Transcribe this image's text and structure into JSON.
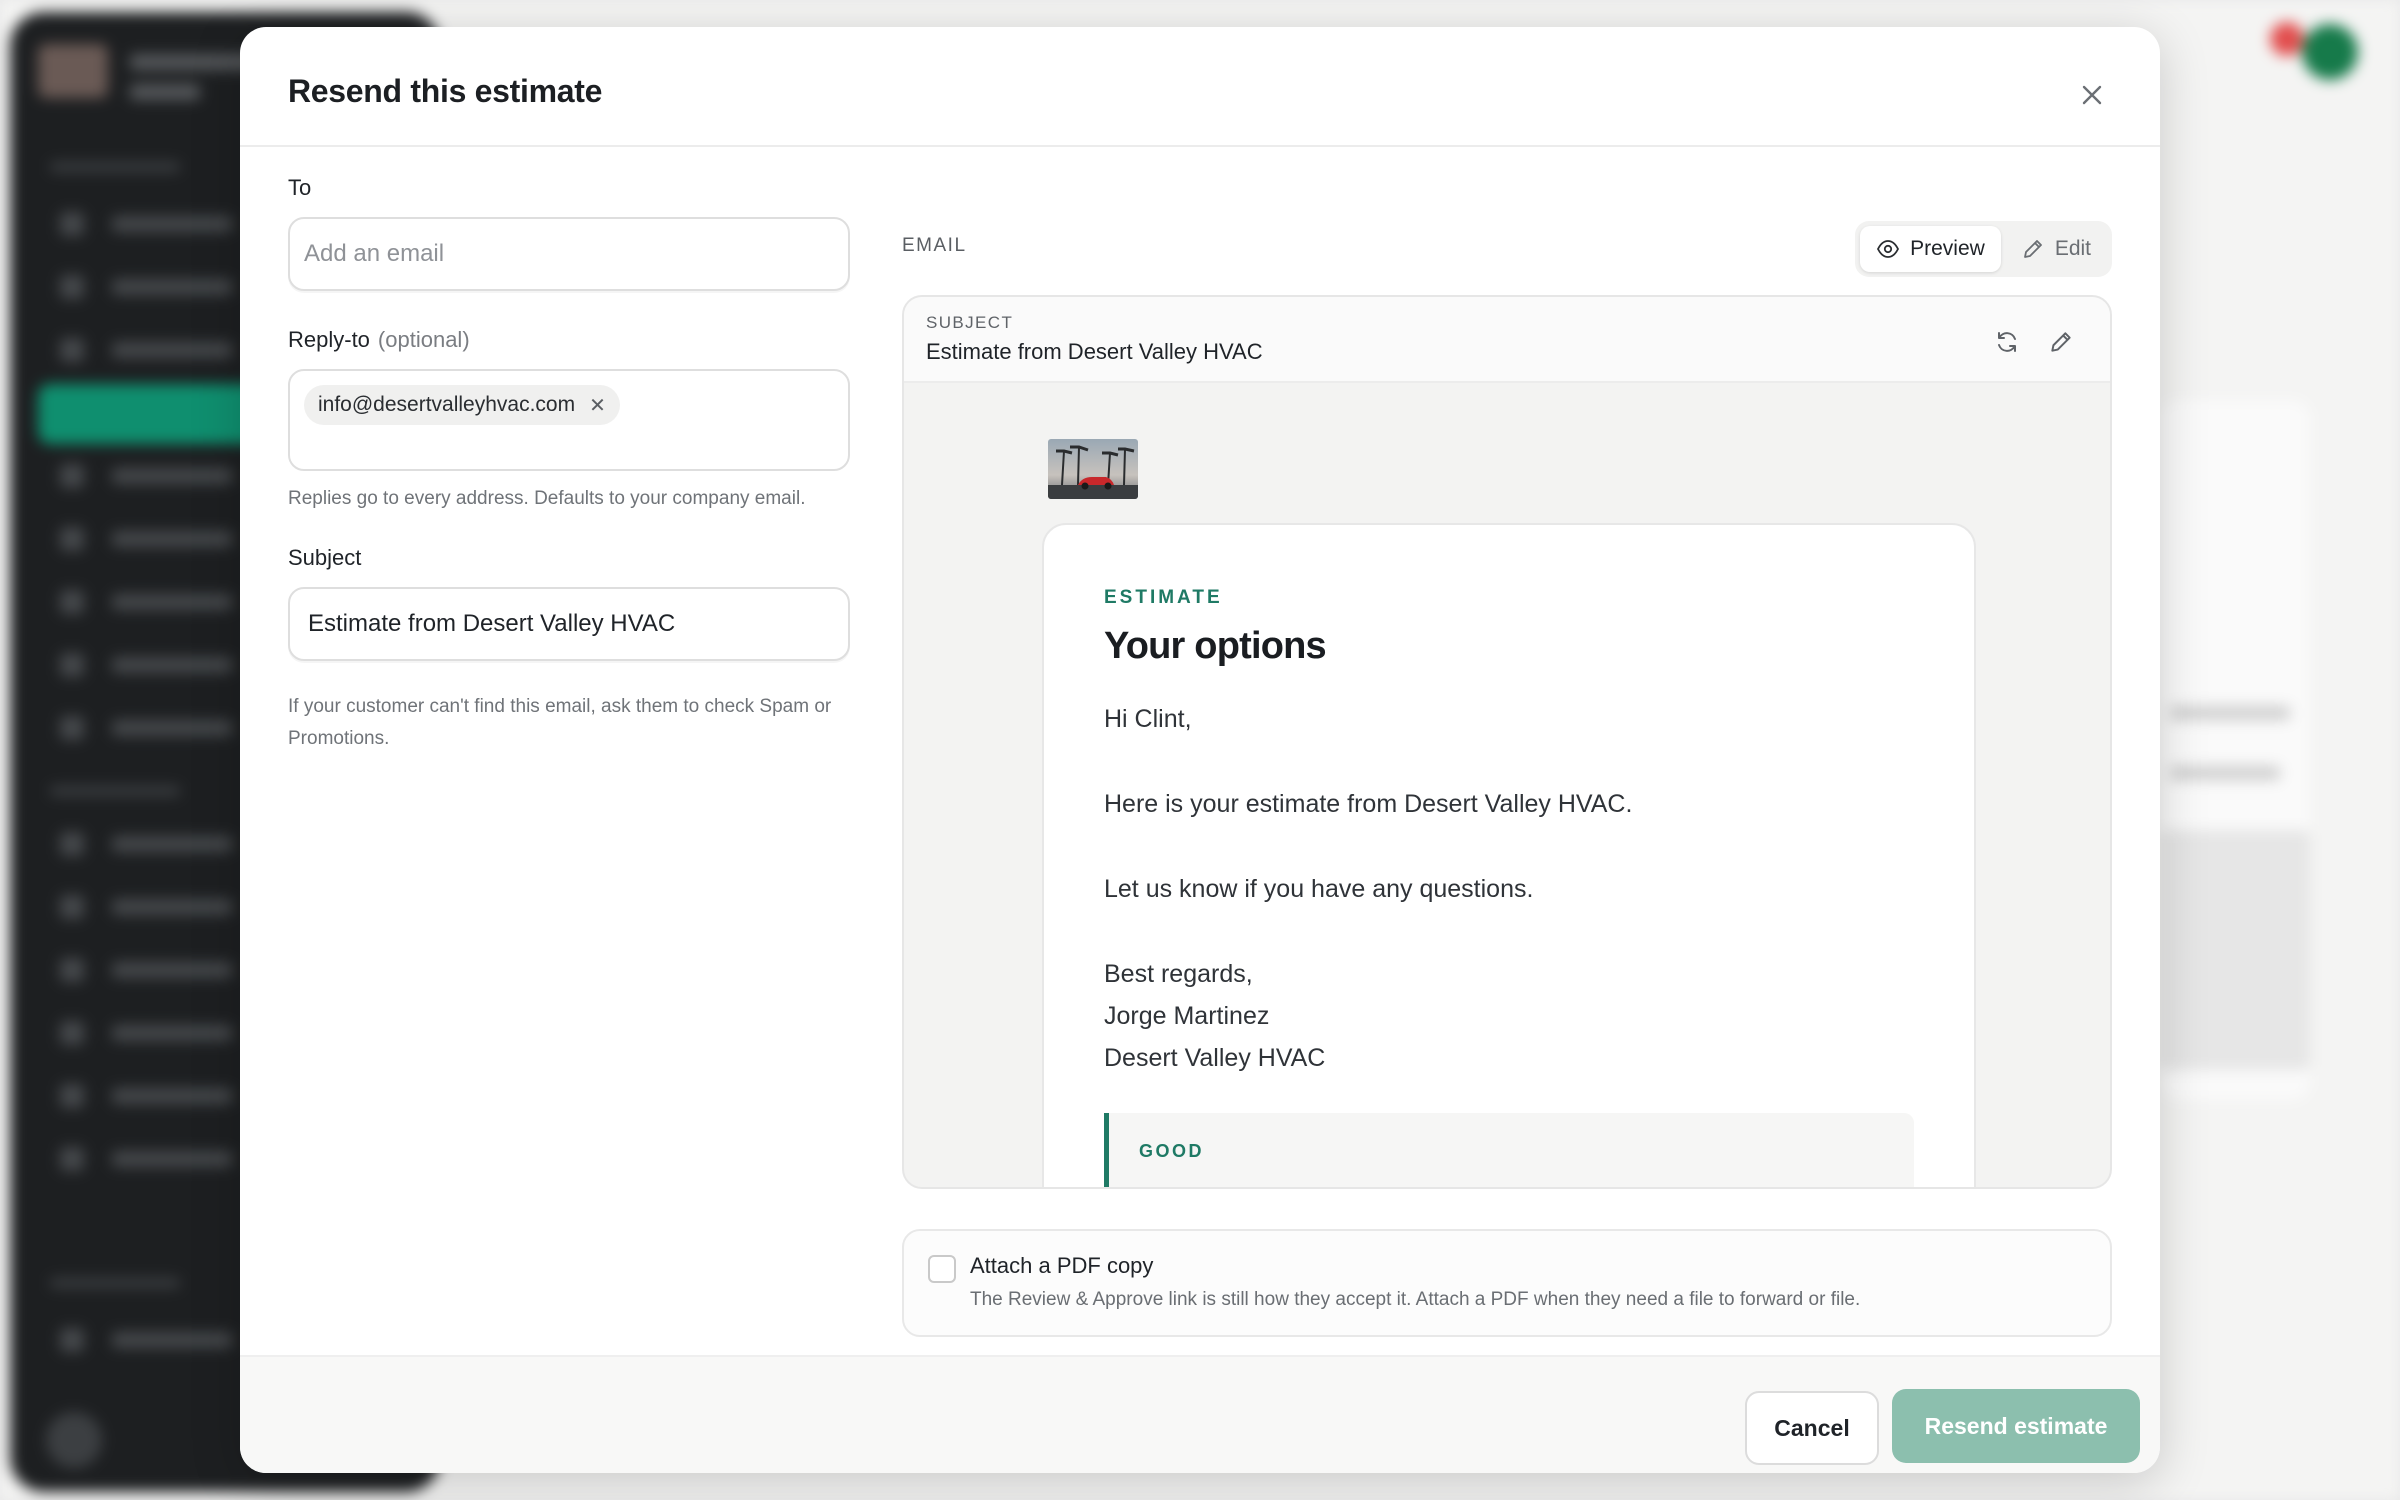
{
  "modal": {
    "title": "Resend this estimate",
    "close_icon": "close-icon"
  },
  "form": {
    "to_label": "To",
    "to_placeholder": "Add an email",
    "to_value": "",
    "reply_to_label": "Reply-to",
    "reply_to_optional": "(optional)",
    "reply_to_chips": [
      "info@desertvalleyhvac.com"
    ],
    "reply_to_hint": "Replies go to every address. Defaults to your company email.",
    "subject_label": "Subject",
    "subject_value": "Estimate from Desert Valley HVAC",
    "spam_hint": "If your customer can't find this email, ask them to check Spam or Promotions."
  },
  "email": {
    "section_label": "EMAIL",
    "view_toggle": {
      "preview_label": "Preview",
      "edit_label": "Edit",
      "active": "Preview"
    },
    "subject_caption": "SUBJECT",
    "subject_text": "Estimate from Desert Valley HVAC",
    "card": {
      "eyebrow": "ESTIMATE",
      "title": "Your options",
      "greeting": "Hi Clint,",
      "line1": "Here is your estimate from Desert Valley HVAC.",
      "line2": "Let us know if you have any questions.",
      "signoff": "Best regards,",
      "sender_name": "Jorge Martinez",
      "sender_company": "Desert Valley HVAC",
      "option_label": "GOOD"
    }
  },
  "attachment": {
    "title": "Attach a PDF copy",
    "description": "The Review & Approve link is still how they accept it. Attach a PDF when they need a file to forward or file.",
    "checked": false
  },
  "footer": {
    "cancel_label": "Cancel",
    "resend_label": "Resend estimate"
  },
  "colors": {
    "accent": "#1f7a65",
    "primary_button_disabled": "#8cbfae",
    "sidebar_active": "#0f8f6f"
  }
}
